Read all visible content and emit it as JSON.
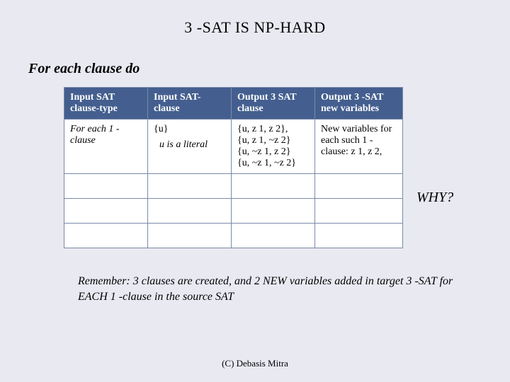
{
  "title": "3 -SAT IS NP-HARD",
  "subtitle": "For each clause do",
  "headers": {
    "c1": "Input SAT clause-type",
    "c2": "Input SAT-clause",
    "c3": "Output 3 SAT clause",
    "c4": "Output 3 -SAT new variables"
  },
  "row1": {
    "c1": "For each 1 -clause",
    "c2_main": "{u}",
    "c2_note": "u is a literal",
    "c3": "{u, z 1, z 2},\n{u, z 1, ~z 2}\n{u, ~z 1, z 2}\n{u, ~z 1, ~z 2}",
    "c4": "New variables for each such 1 -clause: z 1, z 2,"
  },
  "why": "WHY?",
  "remember": "Remember: 3 clauses are created, and 2 NEW variables added in target 3 -SAT for EACH 1 -clause in the source SAT",
  "footer": "(C) Debasis Mitra"
}
